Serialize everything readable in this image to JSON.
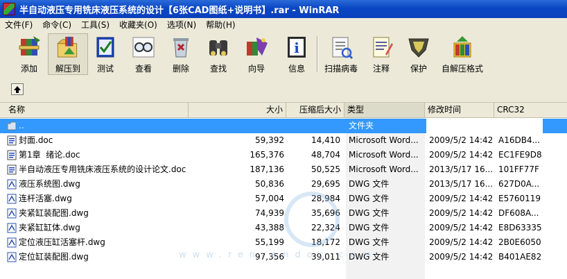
{
  "window": {
    "title": "半自动液压专用铣床液压系统的设计【6张CAD图纸+说明书】.rar - WinRAR"
  },
  "menu": [
    "文件(F)",
    "命令(C)",
    "工具(S)",
    "收藏夹(O)",
    "选项(N)",
    "帮助(H)"
  ],
  "toolbar": {
    "add": "添加",
    "extract": "解压到",
    "test": "测试",
    "view": "查看",
    "delete": "删除",
    "find": "查找",
    "wizard": "向导",
    "info": "信息",
    "scan": "扫描病毒",
    "comment": "注释",
    "protect": "保护",
    "sfx": "自解压格式"
  },
  "watermark": {
    "text": "www.renrendoc.com"
  },
  "columns": {
    "name": "名称",
    "size": "大小",
    "packed": "压缩后大小",
    "type": "类型",
    "modified": "修改时间",
    "crc": "CRC32"
  },
  "rows": [
    {
      "name": "..",
      "size": "",
      "packed": "",
      "type": "文件夹",
      "modified": "",
      "crc": "",
      "icon": "folder-up"
    },
    {
      "name": "封面.doc",
      "size": "59,392",
      "packed": "14,410",
      "type": "Microsoft Word...",
      "modified": "2009/5/2 14:42",
      "crc": "A16DB4...",
      "icon": "doc"
    },
    {
      "name": "第1章  绪论.doc",
      "size": "165,376",
      "packed": "48,704",
      "type": "Microsoft Word...",
      "modified": "2009/5/2 14:42",
      "crc": "EC1FE9D8",
      "icon": "doc"
    },
    {
      "name": "半自动液压专用铣床液压系统的设计论文.doc",
      "size": "187,136",
      "packed": "50,525",
      "type": "Microsoft Word...",
      "modified": "2013/5/17 16...",
      "crc": "101FF77F",
      "icon": "doc"
    },
    {
      "name": "液压系统图.dwg",
      "size": "50,836",
      "packed": "29,695",
      "type": "DWG 文件",
      "modified": "2013/5/17 16...",
      "crc": "627D0A...",
      "icon": "dwg"
    },
    {
      "name": "连杆活塞.dwg",
      "size": "57,004",
      "packed": "28,984",
      "type": "DWG 文件",
      "modified": "2009/5/2 14:42",
      "crc": "E5760119",
      "icon": "dwg"
    },
    {
      "name": "夹紧缸装配图.dwg",
      "size": "74,939",
      "packed": "35,696",
      "type": "DWG 文件",
      "modified": "2009/5/2 14:42",
      "crc": "DF608A...",
      "icon": "dwg"
    },
    {
      "name": "夹紧缸缸体.dwg",
      "size": "43,388",
      "packed": "22,324",
      "type": "DWG 文件",
      "modified": "2009/5/2 14:42",
      "crc": "E8D63335",
      "icon": "dwg"
    },
    {
      "name": "定位液压缸活塞杆.dwg",
      "size": "55,199",
      "packed": "18,172",
      "type": "DWG 文件",
      "modified": "2009/5/2 14:42",
      "crc": "2B0E6050",
      "icon": "dwg"
    },
    {
      "name": "定位缸装配图.dwg",
      "size": "97,356",
      "packed": "39,011",
      "type": "DWG 文件",
      "modified": "2009/5/2 14:42",
      "crc": "B401AE82",
      "icon": "dwg"
    }
  ]
}
